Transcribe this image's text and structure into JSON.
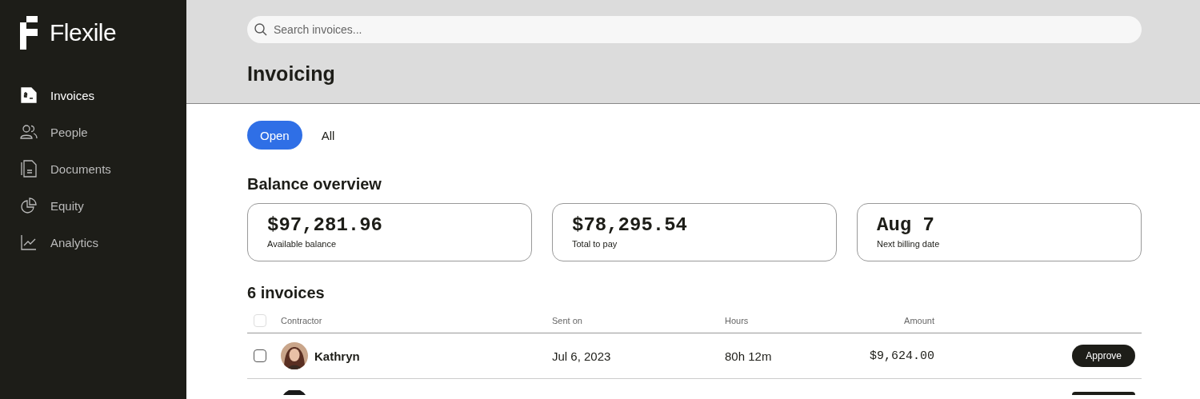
{
  "sidebar": {
    "logo": "Flexile",
    "items": [
      {
        "label": "Invoices",
        "kind": "invoice",
        "selected": true
      },
      {
        "label": "People",
        "kind": "people",
        "selected": false
      },
      {
        "label": "Documents",
        "kind": "documents",
        "selected": false
      },
      {
        "label": "Equity",
        "kind": "equity",
        "selected": false
      },
      {
        "label": "Analytics",
        "kind": "analytics",
        "selected": false
      }
    ]
  },
  "search": {
    "placeholder": "Search invoices..."
  },
  "page_title": "Invoicing",
  "tabs": [
    {
      "label": "Open",
      "selected": true
    },
    {
      "label": "All",
      "selected": false
    }
  ],
  "balance": {
    "title": "Balance overview",
    "cards": [
      {
        "value": "$97,281.96",
        "label": "Available balance"
      },
      {
        "value": "$78,295.54",
        "label": "Total to pay"
      },
      {
        "value": "Aug 7",
        "label": "Next billing date"
      }
    ]
  },
  "invoices": {
    "title": "6 invoices",
    "select_all": {
      "checked": false
    },
    "columns": [
      "Contractor",
      "Sent on",
      "Hours",
      "Amount"
    ],
    "rows": [
      {
        "checked": false,
        "name": "Kathryn",
        "sent_on": "Jul 6, 2023",
        "hours": "80h 12m",
        "amount": "$9,624.00",
        "action": "Approve"
      }
    ]
  }
}
